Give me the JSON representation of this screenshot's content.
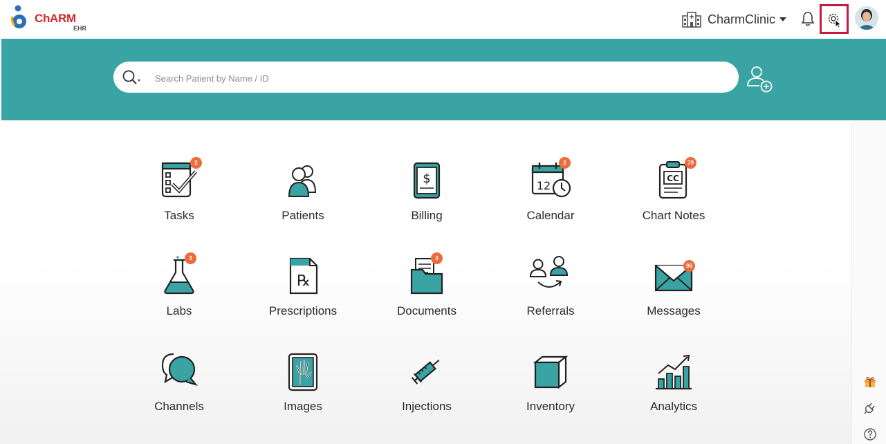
{
  "header": {
    "logo_text": "ChARM",
    "logo_sub": "EHR",
    "clinic_name": "CharmClinic",
    "icons": [
      "bell-icon",
      "gear-icon",
      "user-avatar"
    ]
  },
  "search": {
    "placeholder": "Search Patient by Name / ID"
  },
  "colors": {
    "teal": "#3aa3a3",
    "badge": "#ef6b3b",
    "highlight": "#c8193c",
    "logo_red": "#d3262a"
  },
  "modules": [
    {
      "label": "Tasks",
      "badge": "2"
    },
    {
      "label": "Patients",
      "badge": ""
    },
    {
      "label": "Billing",
      "badge": ""
    },
    {
      "label": "Calendar",
      "badge": "2"
    },
    {
      "label": "Chart Notes",
      "badge": "79"
    },
    {
      "label": "Labs",
      "badge": "3"
    },
    {
      "label": "Prescriptions",
      "badge": ""
    },
    {
      "label": "Documents",
      "badge": "3"
    },
    {
      "label": "Referrals",
      "badge": ""
    },
    {
      "label": "Messages",
      "badge": "96"
    },
    {
      "label": "Channels",
      "badge": ""
    },
    {
      "label": "Images",
      "badge": ""
    },
    {
      "label": "Injections",
      "badge": ""
    },
    {
      "label": "Inventory",
      "badge": ""
    },
    {
      "label": "Analytics",
      "badge": ""
    }
  ],
  "calendar_day": "12",
  "rail_icons": [
    "gift-icon",
    "plug-icon",
    "help-icon"
  ]
}
